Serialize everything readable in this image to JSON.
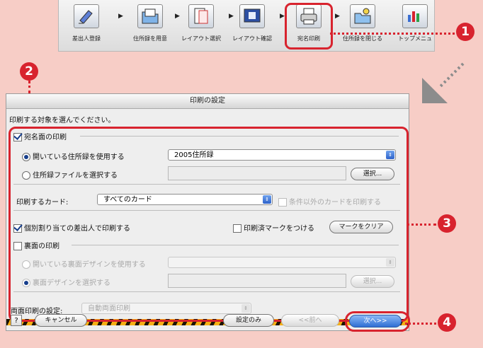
{
  "toolbar": {
    "items": [
      {
        "label": "差出人登録",
        "icon": "sender-register-icon"
      },
      {
        "label": "住所録を用意",
        "icon": "address-book-folder-icon"
      },
      {
        "label": "レイアウト選択",
        "icon": "layout-select-icon"
      },
      {
        "label": "レイアウト確認",
        "icon": "layout-preview-icon"
      },
      {
        "label": "宛名印刷",
        "icon": "printer-icon"
      },
      {
        "label": "住所録を閉じる",
        "icon": "close-address-book-icon"
      },
      {
        "label": "トップメニュ",
        "icon": "top-menu-icon"
      }
    ]
  },
  "callouts": {
    "c1": "1",
    "c2": "2",
    "c3": "3",
    "c4": "4"
  },
  "dialog": {
    "title": "印刷の設定",
    "instruction": "印刷する対象を選んでください。",
    "address_side": {
      "label": "宛名面の印刷",
      "checked": true,
      "use_open_label": "開いている住所録を使用する",
      "use_open_value": "2005住所録",
      "select_file_label": "住所録ファイルを選択する",
      "select_button": "選択..."
    },
    "card": {
      "label": "印刷するカード:",
      "value": "すべてのカード",
      "exclude_label": "条件以外のカードを印刷する"
    },
    "individual_sender": {
      "label": "個別割り当ての差出人で印刷する",
      "checked": true
    },
    "printed_mark": {
      "label": "印刷済マークをつける",
      "checked": false,
      "clear_button": "マークをクリア"
    },
    "back_side": {
      "label": "裏面の印刷",
      "checked": false,
      "use_open_label": "開いている裏面デザインを使用する",
      "select_label": "裏面デザインを選択する",
      "select_button": "選択..."
    },
    "duplex": {
      "label": "両面印刷の設定:",
      "value": "自動両面印刷"
    },
    "buttons": {
      "help": "?",
      "cancel": "キャンセル",
      "settings_only": "設定のみ",
      "prev": "<<前へ",
      "next": "次へ>>"
    }
  },
  "colors": {
    "accent_red": "#d8232e",
    "select_blue": "#2d62c9",
    "background_pink": "#f7cdc6"
  }
}
